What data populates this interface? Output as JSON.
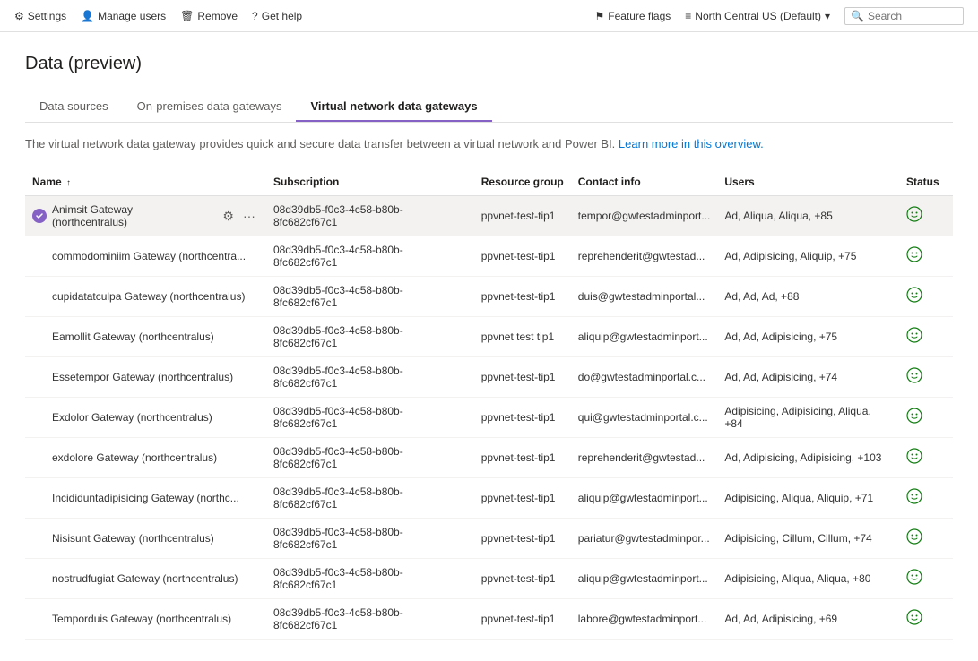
{
  "topbar": {
    "left": [
      {
        "label": "Settings",
        "icon": "gear-icon"
      },
      {
        "label": "Manage users",
        "icon": "user-icon"
      },
      {
        "label": "Remove",
        "icon": "trash-icon"
      },
      {
        "label": "Get help",
        "icon": "help-icon"
      }
    ],
    "right": [
      {
        "label": "Feature flags",
        "icon": "flag-icon"
      },
      {
        "label": "North Central US (Default)",
        "icon": "location-icon"
      },
      {
        "label": "Search",
        "icon": "search-icon"
      }
    ]
  },
  "page": {
    "title": "Data (preview)"
  },
  "tabs": [
    {
      "label": "Data sources",
      "active": false
    },
    {
      "label": "On-premises data gateways",
      "active": false
    },
    {
      "label": "Virtual network data gateways",
      "active": true
    }
  ],
  "description": {
    "text": "The virtual network data gateway provides quick and secure data transfer between a virtual network and Power BI.",
    "link_text": "Learn more in this overview.",
    "link_href": "#"
  },
  "table": {
    "columns": [
      {
        "label": "Name",
        "sort": "↑",
        "key": "name"
      },
      {
        "label": "Subscription",
        "key": "subscription"
      },
      {
        "label": "Resource group",
        "key": "resource_group"
      },
      {
        "label": "Contact info",
        "key": "contact_info"
      },
      {
        "label": "Users",
        "key": "users"
      },
      {
        "label": "Status",
        "key": "status"
      }
    ],
    "rows": [
      {
        "name": "Animsit Gateway (northcentralus)",
        "subscription": "08d39db5-f0c3-4c58-b80b-8fc682cf67c1",
        "resource_group": "ppvnet-test-tip1",
        "contact_info": "tempor@gwtestadminport...",
        "users": "Ad, Aliqua, Aliqua, +85",
        "status": "ok",
        "selected": true,
        "has_icon": true
      },
      {
        "name": "commodominiim Gateway (northcentra...",
        "subscription": "08d39db5-f0c3-4c58-b80b-8fc682cf67c1",
        "resource_group": "ppvnet-test-tip1",
        "contact_info": "reprehenderit@gwtestad...",
        "users": "Ad, Adipisicing, Aliquip, +75",
        "status": "ok",
        "selected": false,
        "has_icon": false
      },
      {
        "name": "cupidatatculpa Gateway (northcentralus)",
        "subscription": "08d39db5-f0c3-4c58-b80b-8fc682cf67c1",
        "resource_group": "ppvnet-test-tip1",
        "contact_info": "duis@gwtestadminportal...",
        "users": "Ad, Ad, Ad, +88",
        "status": "ok",
        "selected": false,
        "has_icon": false
      },
      {
        "name": "Eamollit Gateway (northcentralus)",
        "subscription": "08d39db5-f0c3-4c58-b80b-8fc682cf67c1",
        "resource_group": "ppvnet test tip1",
        "contact_info": "aliquip@gwtestadminport...",
        "users": "Ad, Ad, Adipisicing, +75",
        "status": "ok",
        "selected": false,
        "has_icon": false
      },
      {
        "name": "Essetempor Gateway (northcentralus)",
        "subscription": "08d39db5-f0c3-4c58-b80b-8fc682cf67c1",
        "resource_group": "ppvnet-test-tip1",
        "contact_info": "do@gwtestadminportal.c...",
        "users": "Ad, Ad, Adipisicing, +74",
        "status": "ok",
        "selected": false,
        "has_icon": false
      },
      {
        "name": "Exdolor Gateway (northcentralus)",
        "subscription": "08d39db5-f0c3-4c58-b80b-8fc682cf67c1",
        "resource_group": "ppvnet-test-tip1",
        "contact_info": "qui@gwtestadminportal.c...",
        "users": "Adipisicing, Adipisicing, Aliqua, +84",
        "status": "ok",
        "selected": false,
        "has_icon": false
      },
      {
        "name": "exdolore Gateway (northcentralus)",
        "subscription": "08d39db5-f0c3-4c58-b80b-8fc682cf67c1",
        "resource_group": "ppvnet-test-tip1",
        "contact_info": "reprehenderit@gwtestad...",
        "users": "Ad, Adipisicing, Adipisicing, +103",
        "status": "ok",
        "selected": false,
        "has_icon": false
      },
      {
        "name": "Incididuntadipisicing Gateway (northc...",
        "subscription": "08d39db5-f0c3-4c58-b80b-8fc682cf67c1",
        "resource_group": "ppvnet-test-tip1",
        "contact_info": "aliquip@gwtestadminport...",
        "users": "Adipisicing, Aliqua, Aliquip, +71",
        "status": "ok",
        "selected": false,
        "has_icon": false
      },
      {
        "name": "Nisisunt Gateway (northcentralus)",
        "subscription": "08d39db5-f0c3-4c58-b80b-8fc682cf67c1",
        "resource_group": "ppvnet-test-tip1",
        "contact_info": "pariatur@gwtestadminpor...",
        "users": "Adipisicing, Cillum, Cillum, +74",
        "status": "ok",
        "selected": false,
        "has_icon": false
      },
      {
        "name": "nostrudfugiat Gateway (northcentralus)",
        "subscription": "08d39db5-f0c3-4c58-b80b-8fc682cf67c1",
        "resource_group": "ppvnet-test-tip1",
        "contact_info": "aliquip@gwtestadminport...",
        "users": "Adipisicing, Aliqua, Aliqua, +80",
        "status": "ok",
        "selected": false,
        "has_icon": false
      },
      {
        "name": "Temporduis Gateway (northcentralus)",
        "subscription": "08d39db5-f0c3-4c58-b80b-8fc682cf67c1",
        "resource_group": "ppvnet-test-tip1",
        "contact_info": "labore@gwtestadminport...",
        "users": "Ad, Ad, Adipisicing, +69",
        "status": "ok",
        "selected": false,
        "has_icon": false
      }
    ]
  }
}
